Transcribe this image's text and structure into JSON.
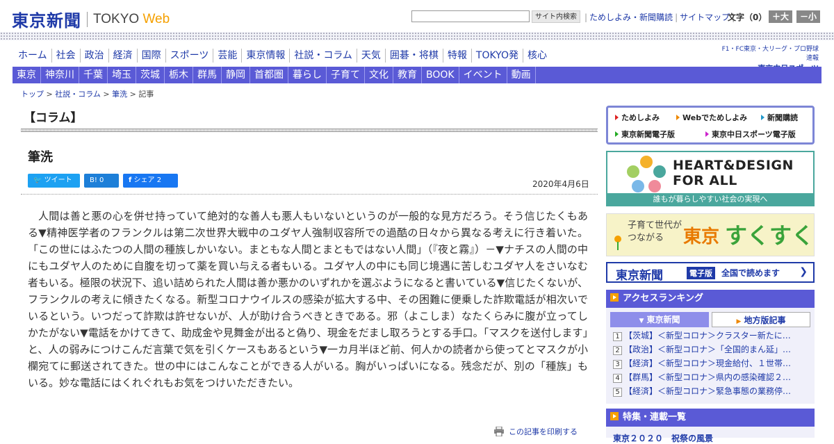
{
  "header": {
    "logo_jp": "東京新聞",
    "logo_en_a": "TOKYO",
    "logo_en_b": "Web",
    "search_button": "サイト内検索",
    "top_links": [
      "ためしよみ・新聞購読",
      "サイトマップ"
    ],
    "text_size_label": "文字（0）",
    "size_up": "＋大",
    "size_down": "－小"
  },
  "nav_main": [
    "ホーム",
    "社会",
    "政治",
    "経済",
    "国際",
    "スポーツ",
    "芸能",
    "東京情報",
    "社説・コラム",
    "天気",
    "囲碁・将棋",
    "特報",
    "TOKYO発",
    "核心"
  ],
  "sports_logo": {
    "line1": "F1・FC東京・大リーグ・プロ野球速報",
    "line2": "東京中日スポーツ"
  },
  "nav_region": [
    "東京",
    "神奈川",
    "千葉",
    "埼玉",
    "茨城",
    "栃木",
    "群馬",
    "静岡",
    "首都圏",
    "暮らし",
    "子育て",
    "文化",
    "教育",
    "BOOK",
    "イベント",
    "動画"
  ],
  "breadcrumb": [
    "トップ",
    "社説・コラム",
    "筆洗",
    "記事"
  ],
  "column_heading": "【コラム】",
  "article": {
    "title": "筆洗",
    "date": "2020年4月6日",
    "share": {
      "tweet": "ツイート",
      "hatena": "B! 0",
      "facebook": "シェア 2"
    },
    "body": "人間は善と悪の心を併せ持っていて絶対的な善人も悪人もいないというのが一般的な見方だろう。そう信じたくもある▼精神医学者のフランクルは第二次世界大戦中のユダヤ人強制収容所での過酷の日々から異なる考えに行き着いた。「この世にはふたつの人間の種族しかいない。まともな人間とまともではない人間」（『夜と霧』）－▼ナチスの人間の中にもユダヤ人のために自腹を切って薬を買い与える者もいる。ユダヤ人の中にも同じ境遇に苦しむユダヤ人をさいなむ者もいる。極限の状況下、追い詰められた人間は善か悪かのいずれかを選ぶようになると書いている▼信じたくないが、フランクルの考えに傾きたくなる。新型コロナウイルスの感染が拡大する中、その困難に便乗した詐欺電話が相次いでいるという。いつだって詐欺は許せないが、人が助け合うべきときである。邪（よこしま）なたくらみに腹が立ってしかたがない▼電話をかけてきて、助成金や見舞金が出ると偽り、現金をだまし取ろうとする手口。「マスクを送付します」と、人の弱みにつけこんだ言葉で気を引くケースもあるという▼一カ月半ほど前、何人かの読者から使ってとマスクが小欄宛てに郵送されてきた。世の中にはこんなことができる人がいる。胸がいっぱいになる。残念だが、別の「種族」もいる。妙な電話にはくれぐれもお気をつけいただきたい。",
    "print_link": "この記事を印刷する"
  },
  "sidebar": {
    "links": [
      "ためしよみ",
      "Webでためしよみ",
      "新聞購読",
      "東京新聞電子版",
      "東京中日スポーツ電子版"
    ],
    "heart_design": {
      "line1": "HEART&DESIGN",
      "line2": "FOR ALL",
      "bar": "誰もが暮らしやすい社会の実現へ"
    },
    "sukusuku": {
      "line1": "子育て世代が",
      "line2": "つながる",
      "brand1": "東京",
      "brand2": "すくすく"
    },
    "denshi": {
      "name": "東京新聞",
      "badge": "電子版",
      "text": "全国で読めます"
    },
    "ranking": {
      "title": "アクセスランキング",
      "tabs": [
        "東京新聞",
        "地方版記事"
      ],
      "items": [
        "【茨城】＜新型コロナ＞クラスター新たに…",
        "【政治】＜新型コロナ＞「全国的まん延」…",
        "【経済】＜新型コロナ＞現金給付、１世帯…",
        "【群馬】＜新型コロナ＞県内の感染確認２…",
        "【経済】＜新型コロナ＞緊急事態の業務停…"
      ]
    },
    "features": {
      "title": "特集・連載一覧",
      "partial": "東京２０２０　祝祭の風景"
    }
  }
}
